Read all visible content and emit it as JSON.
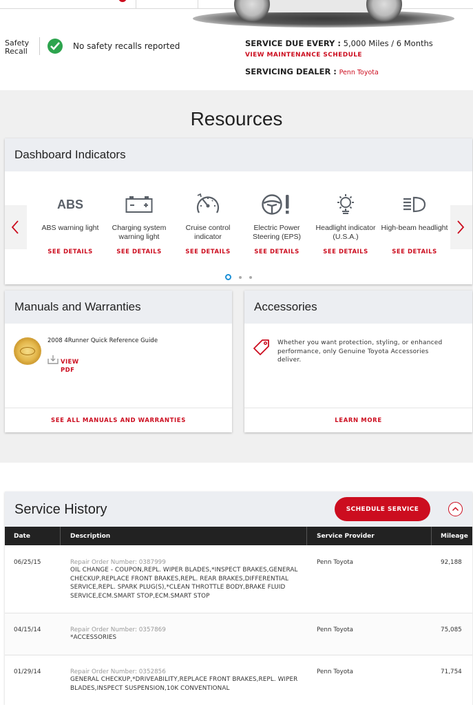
{
  "top": {
    "safety_recall_label": "Safety Recall",
    "recall_status": "No safety recalls reported",
    "service_due_label": "SERVICE DUE EVERY :",
    "service_due_value": "5,000 Miles / 6 Months",
    "view_schedule": "VIEW MAINTENANCE SCHEDULE",
    "dealer_label": "SERVICING DEALER :",
    "dealer_name": "Penn Toyota"
  },
  "resources": {
    "title": "Resources",
    "dashboard": {
      "title": "Dashboard Indicators",
      "see_details": "SEE DETAILS",
      "indicators": [
        {
          "label": "ABS warning light",
          "icon": "abs-icon",
          "icon_text": "ABS"
        },
        {
          "label": "Charging system warning light",
          "icon": "battery-icon"
        },
        {
          "label": "Cruise control indicator",
          "icon": "speedometer-icon"
        },
        {
          "label": "Electric Power Steering (EPS)",
          "icon": "steering-wheel-icon"
        },
        {
          "label": "Headlight indicator (U.S.A.)",
          "icon": "headlight-icon"
        },
        {
          "label": "High-beam headlight",
          "icon": "high-beam-icon"
        }
      ],
      "page_count": 3,
      "active_page": 1
    },
    "manuals": {
      "title": "Manuals and Warranties",
      "guide_title": "2008 4Runner Quick Reference Guide",
      "view_pdf_line1": "VIEW",
      "view_pdf_line2": "PDF",
      "footer": "SEE ALL MANUALS AND WARRANTIES"
    },
    "accessories": {
      "title": "Accessories",
      "text": "Whether you want protection, styling, or enhanced performance, only Genuine Toyota Accessories deliver.",
      "footer": "LEARN MORE"
    }
  },
  "history": {
    "title": "Service History",
    "schedule_button": "SCHEDULE SERVICE",
    "columns": [
      "Date",
      "Description",
      "Service Provider",
      "Mileage"
    ],
    "rows": [
      {
        "date": "06/25/15",
        "ro": "Repair Order Number: 0387999",
        "desc": "OIL CHANGE - COUPON,REPL. WIPER BLADES,*INSPECT BRAKES,GENERAL CHECKUP,REPLACE FRONT BRAKES,REPL. REAR BRAKES,DIFFERENTIAL SERVICE,REPL. SPARK PLUG(S),*CLEAN THROTTLE BODY,BRAKE FLUID SERVICE,ECM.SMART STOP,ECM.SMART STOP",
        "provider": "Penn Toyota",
        "mileage": "92,188"
      },
      {
        "date": "04/15/14",
        "ro": "Repair Order Number: 0357869",
        "desc": "*ACCESSORIES",
        "provider": "Penn Toyota",
        "mileage": "75,085"
      },
      {
        "date": "01/29/14",
        "ro": "Repair Order Number: 0352856",
        "desc": "GENERAL CHECKUP,*DRIVEABILITY,REPLACE FRONT BRAKES,REPL. WIPER BLADES,INSPECT SUSPENSION,10K CONVENTIONAL",
        "provider": "Penn Toyota",
        "mileage": "71,754"
      }
    ]
  },
  "colors": {
    "accent": "#cc0d1f",
    "success": "#2da44e",
    "header_bg": "#eceef2",
    "table_head": "#222222",
    "carousel_dot_active": "#1a8fd6"
  }
}
